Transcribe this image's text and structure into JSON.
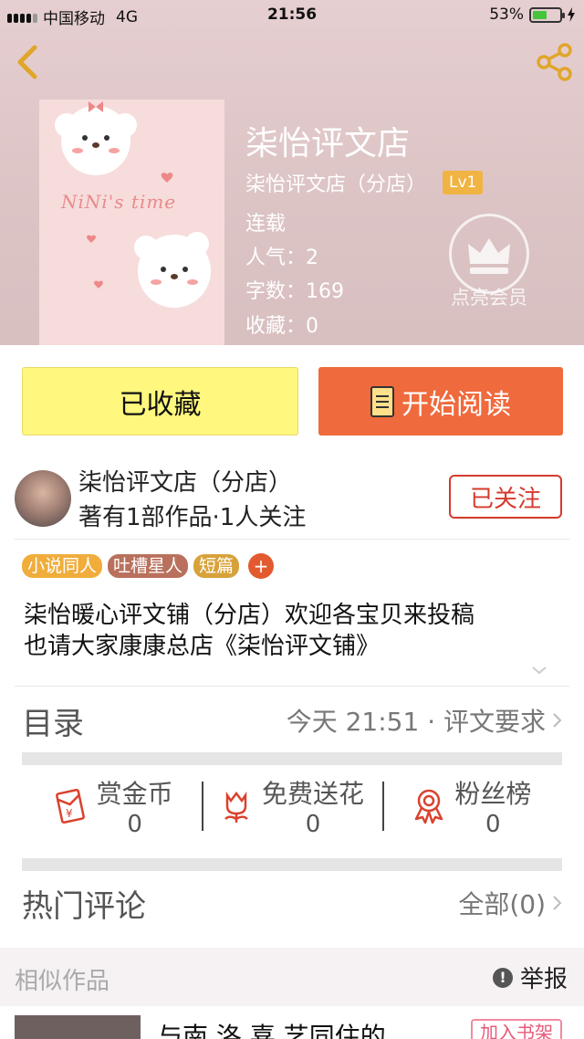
{
  "status_bar": {
    "carrier": "中国移动",
    "network": "4G",
    "time": "21:56",
    "battery_text": "53%",
    "battery_level": 0.53
  },
  "cover": {
    "text": "NiNi's time"
  },
  "book": {
    "title": "柒怡评文店",
    "author": "柒怡评文店（分店）",
    "level": "Lv1",
    "status": "连载",
    "popularity": "人气：2",
    "word_count": "字数：169",
    "favorites": "收藏：0",
    "vip_label": "点亮会员"
  },
  "actions": {
    "favorite_label": "已收藏",
    "read_label": "开始阅读"
  },
  "author_profile": {
    "name": "柒怡评文店（分店）",
    "stats": "著有1部作品·1人关注",
    "follow_label": "已关注"
  },
  "tags": [
    {
      "label": "小说同人",
      "color": "#f0ad3c"
    },
    {
      "label": "吐槽星人",
      "color": "#b9715d"
    },
    {
      "label": "短篇",
      "color": "#d8a23a"
    }
  ],
  "tag_add": "+",
  "description": [
    "柒怡暖心评文铺（分店）欢迎各宝贝来投稿",
    "也请大家康康总店《柒怡评文铺》"
  ],
  "catalog": {
    "title": "目录",
    "latest": "今天 21:51 · 评文要求"
  },
  "stats": [
    {
      "label": "赏金币",
      "value": "0",
      "icon": "red-envelope-icon"
    },
    {
      "label": "免费送花",
      "value": "0",
      "icon": "flower-icon"
    },
    {
      "label": "粉丝榜",
      "value": "0",
      "icon": "ribbon-medal-icon"
    }
  ],
  "comments": {
    "title": "热门评论",
    "all_label": "全部(0)"
  },
  "similar": {
    "title": "相似作品",
    "report_label": "举报",
    "first_item_title": "与南 洛 喜 艺同住的",
    "add_shelf_label": "加入书架"
  },
  "colors": {
    "accent_orange": "#ef6a3d",
    "favorite_yellow": "#fff77e",
    "follow_red": "#d53a2e"
  }
}
